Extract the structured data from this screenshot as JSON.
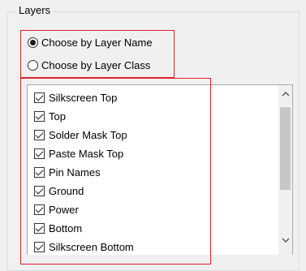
{
  "groupbox": {
    "title": "Layers"
  },
  "radios": [
    {
      "label": "Choose by Layer Name",
      "checked": true
    },
    {
      "label": "Choose by Layer Class",
      "checked": false
    }
  ],
  "layers": [
    {
      "label": "Silkscreen Top",
      "checked": true
    },
    {
      "label": "Top",
      "checked": true
    },
    {
      "label": "Solder Mask Top",
      "checked": true
    },
    {
      "label": "Paste Mask Top",
      "checked": true
    },
    {
      "label": "Pin Names",
      "checked": true
    },
    {
      "label": "Ground",
      "checked": true
    },
    {
      "label": "Power",
      "checked": true
    },
    {
      "label": "Bottom",
      "checked": true
    },
    {
      "label": "Silkscreen Bottom",
      "checked": true
    }
  ],
  "scrollbar": {
    "up_icon": "chevron-up-icon",
    "down_icon": "chevron-down-icon"
  },
  "colors": {
    "highlight": "#e0202a"
  }
}
